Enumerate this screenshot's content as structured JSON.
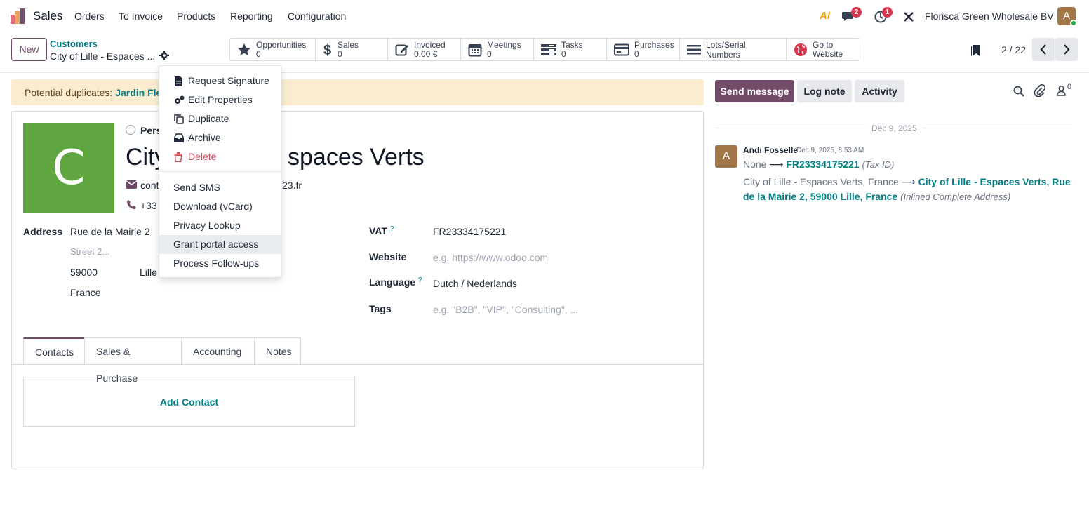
{
  "navbar": {
    "app_name": "Sales",
    "menu": [
      "Orders",
      "To Invoice",
      "Products",
      "Reporting",
      "Configuration"
    ],
    "ai_label": "AI",
    "messages_count": "2",
    "activities_count": "1",
    "company": "Florisca Green Wholesale BV",
    "user_initial": "A"
  },
  "control": {
    "new_label": "New",
    "breadcrumb_parent": "Customers",
    "breadcrumb_current": "City of Lille - Espaces ...",
    "smart_buttons": [
      {
        "icon": "star-icon",
        "label": "Opportunities",
        "value": "0"
      },
      {
        "icon": "dollar-icon",
        "label": "Sales",
        "value": "0"
      },
      {
        "icon": "invoice-edit-icon",
        "label": "Invoiced",
        "value": "0.00 €"
      },
      {
        "icon": "calendar-icon",
        "label": "Meetings",
        "value": "0"
      },
      {
        "icon": "tasks-icon",
        "label": "Tasks",
        "value": "0"
      },
      {
        "icon": "credit-card-icon",
        "label": "Purchases",
        "value": "0"
      },
      {
        "icon": "list-icon",
        "label": "Lots/Serial Numbers",
        "value": ""
      },
      {
        "icon": "globe-icon",
        "label": "Go to Website",
        "value": ""
      }
    ],
    "pager": "2 / 22"
  },
  "form": {
    "duplicates_label": "Potential duplicates:",
    "duplicates_link": "Jardin Fle",
    "avatar_letter": "C",
    "company_type": "Pers",
    "name_left": "City",
    "name_right": "spaces Verts",
    "email_partial_left": "cont",
    "email_partial_right": "23.fr",
    "phone_partial": "+33",
    "address_label": "Address",
    "street": "Rue de la Mairie 2",
    "street2_placeholder": "Street 2...",
    "zip": "59000",
    "city": "Lille",
    "country": "France",
    "vat_label": "VAT",
    "vat_value": "FR23334175221",
    "website_label": "Website",
    "website_placeholder": "e.g. https://www.odoo.com",
    "language_label": "Language",
    "language_value": "Dutch / Nederlands",
    "tags_label": "Tags",
    "tags_placeholder": "e.g. \"B2B\", \"VIP\", \"Consulting\", ...",
    "help_mark": "?",
    "tabs": [
      "Contacts",
      "Sales & Purchase",
      "Accounting",
      "Notes"
    ],
    "add_contact": "Add Contact"
  },
  "dropdown": {
    "items_top": [
      {
        "icon": "file-signature-icon",
        "label": "Request Signature"
      },
      {
        "icon": "cogs-icon",
        "label": "Edit Properties"
      },
      {
        "icon": "copy-icon",
        "label": "Duplicate"
      },
      {
        "icon": "archive-icon",
        "label": "Archive"
      },
      {
        "icon": "trash-icon",
        "label": "Delete"
      }
    ],
    "items_bottom": [
      "Send SMS",
      "Download (vCard)",
      "Privacy Lookup",
      "Grant portal access",
      "Process Follow-ups"
    ]
  },
  "chatter": {
    "send_message": "Send message",
    "log_note": "Log note",
    "activity": "Activity",
    "followers_count": "0",
    "date": "Dec 9, 2025",
    "author_initial": "A",
    "author": "Andi Fosselle",
    "time": "Dec 9, 2025, 8:53 AM",
    "change1_old": "None",
    "change1_new": "FR23334175221",
    "change1_field": "(Tax ID)",
    "change2_old": "City of Lille - Espaces Verts, France",
    "change2_new": "City of Lille - Espaces Verts, Rue de la Mairie 2, 59000 Lille, France",
    "change2_field": "(Inlined Complete Address)",
    "arrow": "⟶"
  },
  "colors": {
    "brand": "#714b67",
    "link": "#017e84",
    "avatar_green": "#5fa641",
    "banner": "#fbecd0",
    "danger": "#d44c59"
  }
}
